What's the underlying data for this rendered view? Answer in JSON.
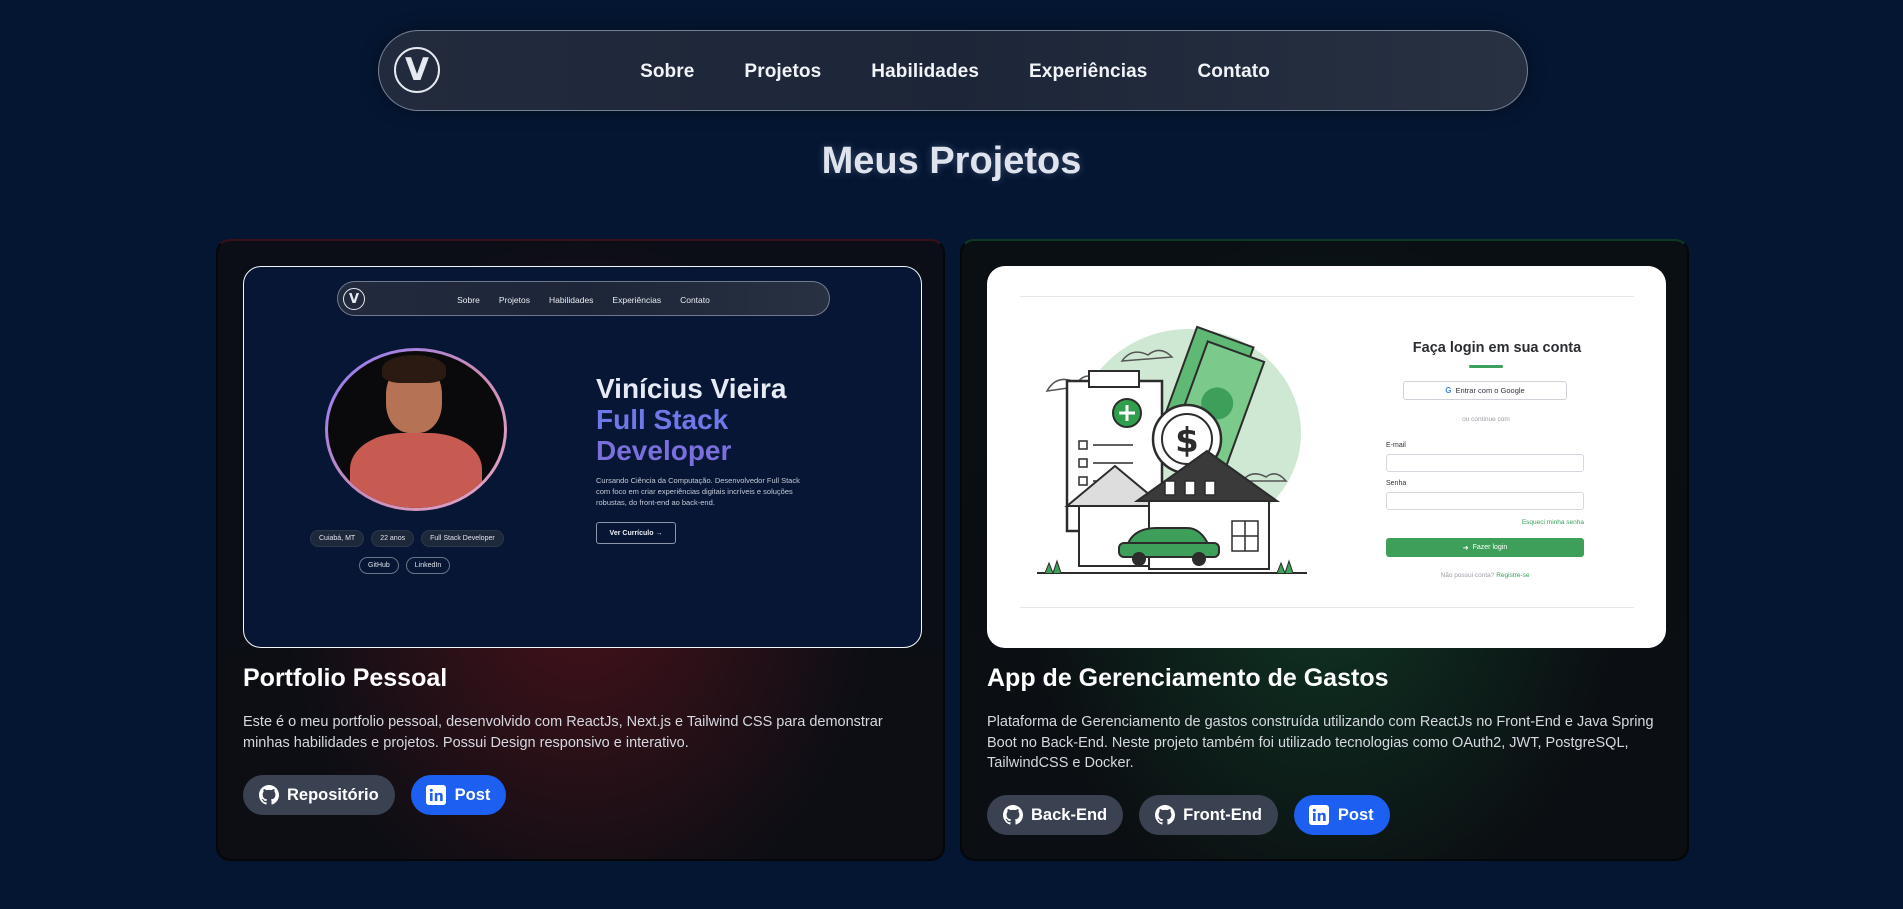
{
  "nav": {
    "logo_letter": "V",
    "links": [
      "Sobre",
      "Projetos",
      "Habilidades",
      "Experiências",
      "Contato"
    ]
  },
  "section_title": "Meus Projetos",
  "projects": [
    {
      "title": "Portfolio Pessoal",
      "description": "Este é o meu portfolio pessoal, desenvolvido com ReactJs, Next.js e Tailwind CSS para demonstrar minhas habilidades e projetos. Possui Design responsivo e interativo.",
      "buttons": [
        {
          "label": "Repositório",
          "icon": "github-icon"
        },
        {
          "label": "Post",
          "icon": "linkedin-icon"
        }
      ],
      "preview": {
        "nav_links": [
          "Sobre",
          "Projetos",
          "Habilidades",
          "Experiências",
          "Contato"
        ],
        "logo_letter": "V",
        "name_line": "Vinícius Vieira",
        "role_line1": "Full Stack",
        "role_line2": "Developer",
        "bio": "Cursando Ciência da Computação. Desenvolvedor Full Stack com foco em criar experiências digitais incríveis e soluções robustas, do front-end ao back-end.",
        "cv_button": "Ver Currículo →",
        "chips": [
          "Cuiabá, MT",
          "22 anos",
          "Full Stack Developer"
        ],
        "social_chips": [
          "GitHub",
          "LinkedIn"
        ]
      }
    },
    {
      "title": "App de Gerenciamento de Gastos",
      "description": "Plataforma de Gerenciamento de gastos construída utilizando com ReactJs no Front-End e Java Spring Boot no Back-End. Neste projeto também foi utilizado tecnologias como OAuth2, JWT, PostgreSQL, TailwindCSS e Docker.",
      "buttons": [
        {
          "label": "Back-End",
          "icon": "github-icon"
        },
        {
          "label": "Front-End",
          "icon": "github-icon"
        },
        {
          "label": "Post",
          "icon": "linkedin-icon"
        }
      ],
      "preview": {
        "login_title": "Faça login em sua conta",
        "google_button": "Entrar com o Google",
        "divider_text": "ou continue com",
        "email_label": "E-mail",
        "password_label": "Senha",
        "forgot_link": "Esqueci minha senha",
        "login_button": "Fazer login",
        "register_prefix": "Não possui conta?",
        "register_link": "Registre-se"
      }
    }
  ],
  "colors": {
    "background": "#051632",
    "button_gray": "#3a4252",
    "button_blue": "#1d5ff0",
    "accent_green": "#3d9f59"
  }
}
